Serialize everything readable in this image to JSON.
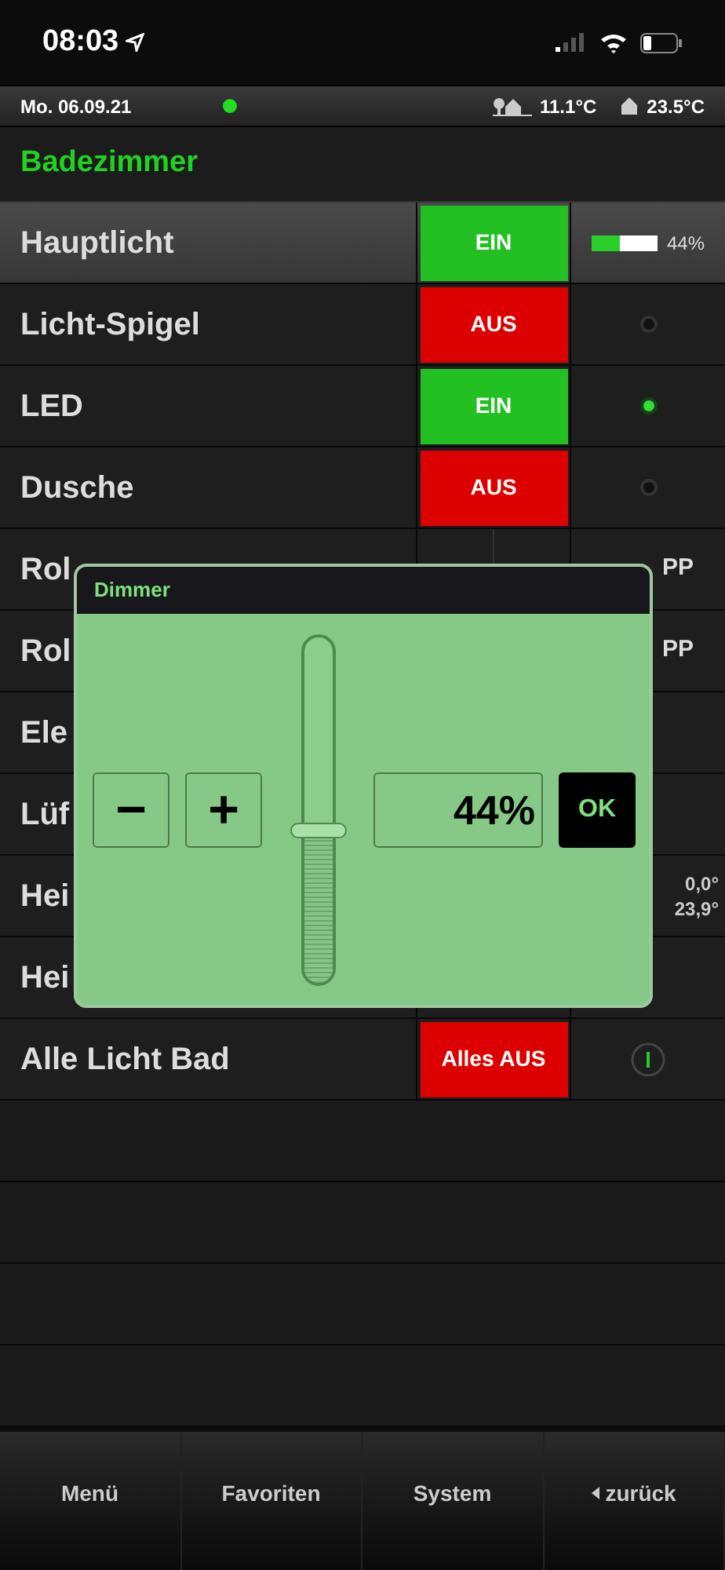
{
  "status_bar": {
    "time": "08:03"
  },
  "info_bar": {
    "date": "Mo. 06.09.21",
    "online": true,
    "outdoor_temp": "11.1°C",
    "indoor_temp": "23.5°C"
  },
  "room": {
    "title": "Badezimmer"
  },
  "rows": [
    {
      "kind": "dimmer",
      "label": "Hauptlicht",
      "selected": true,
      "button": {
        "label": "EIN",
        "on": true
      },
      "level": 0.44,
      "reading": "44%"
    },
    {
      "kind": "switch",
      "label": "Licht-Spigel",
      "selected": false,
      "button": {
        "label": "AUS",
        "on": false
      },
      "lit": false
    },
    {
      "kind": "switch",
      "label": "LED",
      "selected": false,
      "button": {
        "label": "EIN",
        "on": true
      },
      "lit": true
    },
    {
      "kind": "switch",
      "label": "Dusche",
      "selected": false,
      "button": {
        "label": "AUS",
        "on": false
      },
      "lit": false
    },
    {
      "kind": "shutter",
      "label": "Rol",
      "selected": false,
      "action": "PP"
    },
    {
      "kind": "shutter",
      "label": "Rol",
      "selected": false,
      "action": "PP"
    },
    {
      "kind": "plain",
      "label": "Ele",
      "selected": false
    },
    {
      "kind": "plain",
      "label": "Lüf",
      "selected": false
    },
    {
      "kind": "heating",
      "label": "Hei",
      "selected": false,
      "readings": [
        "0,0°",
        "23,9°"
      ]
    },
    {
      "kind": "plain",
      "label": "Hei",
      "selected": false
    },
    {
      "kind": "all_off",
      "label": "Alle Licht Bad",
      "selected": false,
      "button": {
        "label": "Alles AUS",
        "on": false
      }
    }
  ],
  "dialog": {
    "title": "Dimmer",
    "minus": "−",
    "plus": "+",
    "level": 0.44,
    "value": "44%",
    "ok": "OK"
  },
  "footer": [
    {
      "label": "Menü"
    },
    {
      "label": "Favoriten"
    },
    {
      "label": "System"
    },
    {
      "label": "zurück",
      "back": true
    }
  ]
}
